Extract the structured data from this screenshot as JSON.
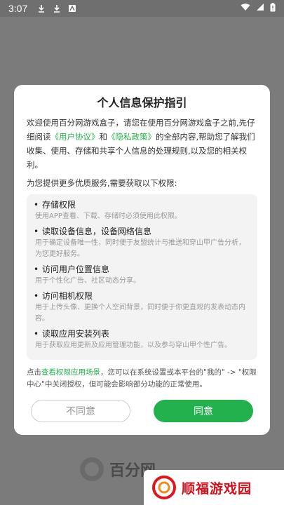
{
  "status_bar": {
    "time": "3:07"
  },
  "dialog": {
    "title": "个人信息保护指引",
    "intro_before": "欢迎使用百分网游戏盒子，请您在使用百分网游戏盒子之前,先仔细阅读",
    "user_agreement_link": "《用户协议》",
    "and_text": "和",
    "privacy_policy_link": "《隐私政策》",
    "intro_after": "的全部内容,帮助您了解我们收集、使用、存储和共享个人信息的处理规则,以及您的相关权利。",
    "subtitle": "为您提供更多优质服务,需要获取以下权限:",
    "permissions": [
      {
        "title": "存储权限",
        "desc": "使用APP查看、下载、存储时必须使用此权限。"
      },
      {
        "title": "读取设备信息，设备网络信息",
        "desc": "用于确定设备唯一性，同时便于友盟统计与推送和穿山甲广告分析，为您更好服务。"
      },
      {
        "title": "访问用户位置信息",
        "desc": "用于个性化广告、社区动态分享。"
      },
      {
        "title": "访问相机权限",
        "desc": "用于上传头像、更换个人空间背景，同时便于你更直观的发表动态内容。"
      },
      {
        "title": "读取应用安装列表",
        "desc": "用于获取应用更新及应用管理功能，以及参与穿山甲个性广告。"
      }
    ],
    "footer_before": "点击",
    "footer_link": "查看权限应用场景",
    "footer_after": "，您可以在系统设置或本平台的\"我的\" -> \"权限中心\"中关闭授权，但可能会影响部分功能的正常使用。",
    "disagree_label": "不同意",
    "agree_label": "同意"
  },
  "background": {
    "logo_text": "百分网"
  },
  "watermark": {
    "text": "顺福游戏园"
  },
  "colors": {
    "accent": "#22b14c",
    "link": "#26b24a",
    "overlay": "#7b7b7b"
  }
}
